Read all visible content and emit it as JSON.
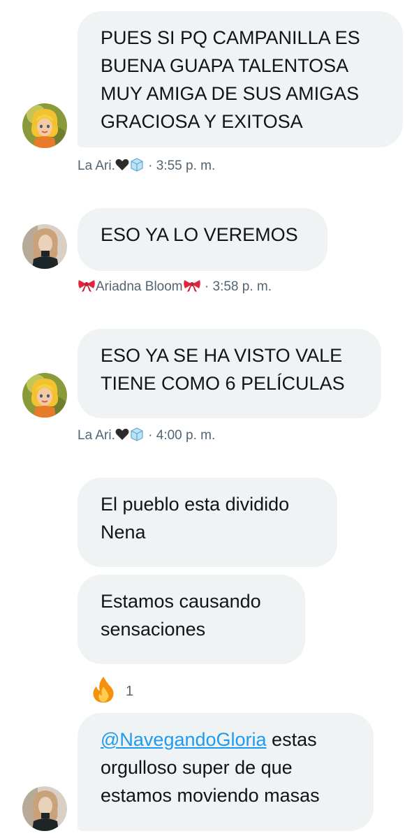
{
  "messages": [
    {
      "text": "PUES SI PQ CAMPANILLA ES BUENA GUAPA TALENTOSA MUY AMIGA DE SUS AMIGAS GRACIOSA Y EXITOSA"
    },
    {
      "text": "ESO YA LO VEREMOS"
    },
    {
      "text": "ESO YA SE HA VISTO VALE TIENE COMO 6 PELÍCULAS"
    },
    {
      "text": "El pueblo esta dividido Nena"
    },
    {
      "text": "Estamos causando sensaciones"
    },
    {
      "mention": "@NavegandoGloria",
      "text": " estas orgulloso super de que estamos moviendo masas"
    }
  ],
  "senders": {
    "ari": {
      "name": "La Ari.",
      "emoji_icons": [
        "black-heart-icon",
        "ice-cube-icon"
      ]
    },
    "ariadna": {
      "name": "Ariadna Bloom",
      "emoji_icons": [
        "ribbon-icon",
        "ribbon-icon"
      ]
    }
  },
  "meta": [
    {
      "sep": "·",
      "time": "3:55 p. m."
    },
    {
      "sep": "·",
      "time": "3:58 p. m."
    },
    {
      "sep": "·",
      "time": "4:00 p. m."
    }
  ],
  "reaction": {
    "icon": "fire-icon",
    "count": "1"
  },
  "colors": {
    "bubble_bg": "#eff3f4",
    "text": "#0f1419",
    "meta_text": "#536471",
    "mention": "#1d9bf0",
    "ribbon": "#e0243e"
  }
}
